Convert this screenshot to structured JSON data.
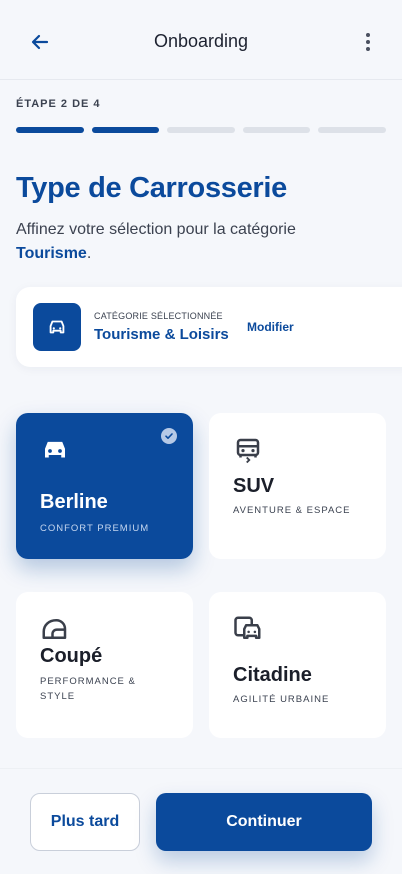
{
  "header": {
    "title": "Onboarding"
  },
  "progress": {
    "label": "ÉTAPE 2 DE 4",
    "current": 2,
    "total": 4
  },
  "page": {
    "heading": "Type de Carrosserie",
    "subtitle_text": "Affinez votre sélection pour la catégorie ",
    "subtitle_highlight": "Tourisme",
    "subtitle_end": "."
  },
  "category": {
    "label": "CATÉGORIE SÉLECTIONNÉE",
    "value": "Tourisme & Loisirs",
    "action": "Modifier"
  },
  "options": [
    {
      "name": "Berline",
      "desc": "CONFORT PREMIUM",
      "selected": true,
      "icon": "car-front-icon"
    },
    {
      "name": "SUV",
      "desc": "AVENTURE & ESPACE",
      "selected": false,
      "icon": "suv-icon"
    },
    {
      "name": "Coupé",
      "desc": "PERFORMANCE & STYLE",
      "selected": false,
      "icon": "coupe-icon"
    },
    {
      "name": "Citadine",
      "desc": "AGILITÉ URBAINE",
      "selected": false,
      "icon": "city-car-icon"
    }
  ],
  "footer": {
    "later": "Plus tard",
    "continue": "Continuer"
  },
  "colors": {
    "primary": "#0b4a9c",
    "background": "#f5f7fb"
  }
}
